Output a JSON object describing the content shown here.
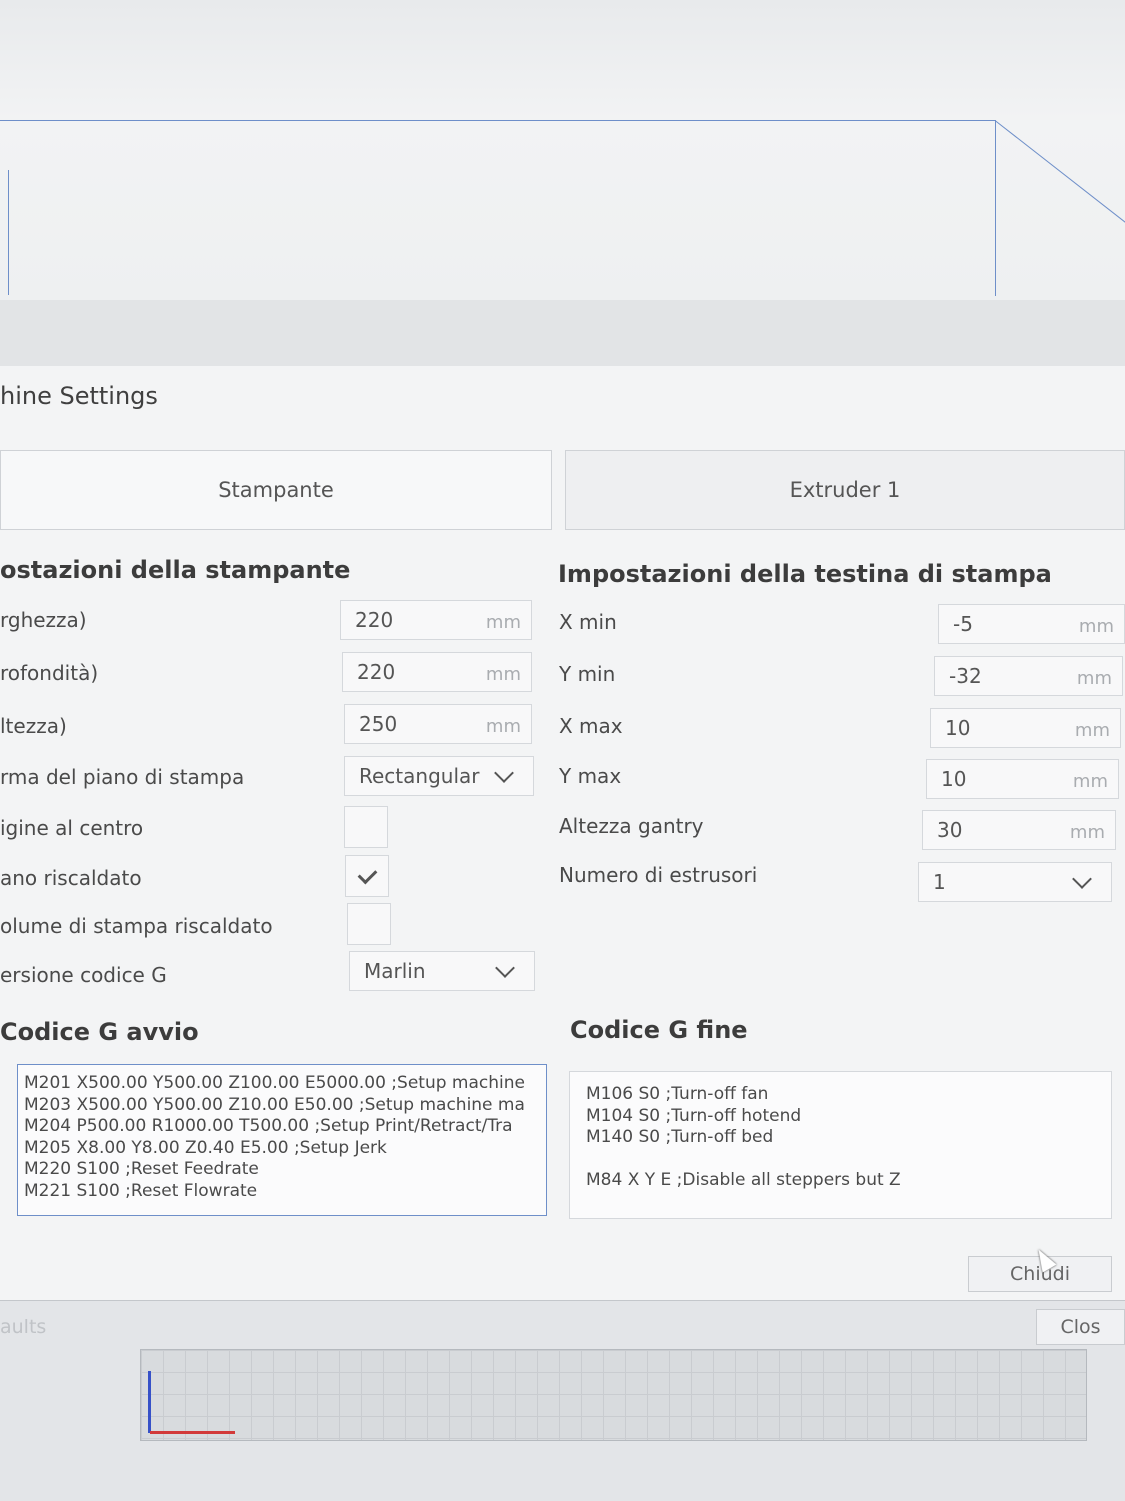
{
  "dialog": {
    "title": "hine Settings",
    "tabs": [
      {
        "label": "Stampante"
      },
      {
        "label": "Extruder 1"
      }
    ]
  },
  "printer_settings": {
    "title": "ostazioni della stampante",
    "width": {
      "label": "rghezza)",
      "value": "220",
      "unit": "mm"
    },
    "depth": {
      "label": "rofondità)",
      "value": "220",
      "unit": "mm"
    },
    "height": {
      "label": "ltezza)",
      "value": "250",
      "unit": "mm"
    },
    "bed_shape": {
      "label": "rma del piano di stampa",
      "value": "Rectangular"
    },
    "origin_center": {
      "label": "igine al centro",
      "checked": false
    },
    "heated_bed": {
      "label": "ano riscaldato",
      "checked": true
    },
    "heated_volume": {
      "label": "olume di stampa riscaldato",
      "checked": false
    },
    "gcode_flavor": {
      "label": "ersione codice G",
      "value": "Marlin"
    }
  },
  "printhead_settings": {
    "title": "Impostazioni della testina di stampa",
    "x_min": {
      "label": "X min",
      "value": "-5",
      "unit": "mm"
    },
    "y_min": {
      "label": "Y min",
      "value": "-32",
      "unit": "mm"
    },
    "x_max": {
      "label": "X max",
      "value": "10",
      "unit": "mm"
    },
    "y_max": {
      "label": "Y max",
      "value": "10",
      "unit": "mm"
    },
    "gantry_height": {
      "label": "Altezza gantry",
      "value": "30",
      "unit": "mm"
    },
    "extruder_count": {
      "label": "Numero di estrusori",
      "value": "1"
    }
  },
  "start_gcode": {
    "title": "Codice G avvio",
    "text": "M201 X500.00 Y500.00 Z100.00 E5000.00 ;Setup machine\nM203 X500.00 Y500.00 Z10.00 E50.00 ;Setup machine ma\nM204 P500.00 R1000.00 T500.00 ;Setup Print/Retract/Tra\nM205 X8.00 Y8.00 Z0.40 E5.00 ;Setup Jerk\nM220 S100 ;Reset Feedrate\nM221 S100 ;Reset Flowrate"
  },
  "end_gcode": {
    "title": "Codice G fine",
    "text": "M106 S0 ;Turn-off fan\nM104 S0 ;Turn-off hotend\nM140 S0 ;Turn-off bed\n\nM84 X Y E ;Disable all steppers but Z"
  },
  "buttons": {
    "chiudi": "Chiudi",
    "close": "Clos",
    "defaults": "aults"
  }
}
